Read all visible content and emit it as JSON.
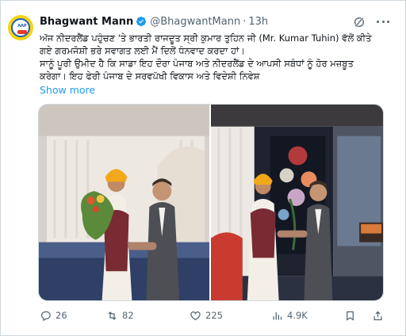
{
  "tweet": {
    "author_name": "Bhagwant Mann",
    "handle": "@BhagwantMann",
    "separator": "·",
    "time": "13h",
    "text_lines": [
      "ਅੱਜ ਨੀਦਰਲੈਂਡ ਪਹੁੰਚਣ 'ਤੇ ਭਾਰਤੀ ਰਾਜਦੂਤ ਸ੍ਰੀ ਕੁਮਾਰ ਤੁਹਿਨ ਜੀ (Mr. Kumar Tuhin) ਵੱਲੋਂ ਕੀਤੇ",
      "ਗਏ ਗਰਮਜੋਸ਼ੀ ਭਰੇ ਸਵਾਗਤ ਲਈ ਮੈਂ ਦਿਲੋਂ ਧੰਨਵਾਦ ਕਰਦਾ ਹਾਂ।",
      "ਸਾਨੂੰ ਪੂਰੀ ਉਮੀਦ ਹੈ ਕਿ ਸਾਡਾ ਇਹ ਦੌਰਾ ਪੰਜਾਬ ਅਤੇ ਨੀਦਰਲੈਂਡ ਦੇ ਆਪਸੀ ਸਬੰਧਾਂ ਨੂੰ ਹੋਰ ਮਜ਼ਬੂਤ",
      "ਕਰੇਗਾ। ਇਹ ਫੇਰੀ ਪੰਜਾਬ ਦੇ ਸਰਵਪੱਖੀ ਵਿਕਾਸ ਅਤੇ ਵਿਦੇਸ਼ੀ ਨਿਵੇਸ਼"
    ],
    "show_more": "Show more"
  },
  "actions": {
    "replies": "26",
    "reposts": "82",
    "likes": "225",
    "views": "4.9K"
  },
  "icons": {
    "verified": "verified-badge-icon",
    "grok": "grok-icon",
    "more": "more-options-icon",
    "reply": "reply-icon",
    "repost": "repost-icon",
    "like": "heart-icon",
    "views": "views-chart-icon",
    "bookmark": "bookmark-icon",
    "share": "share-icon"
  },
  "colors": {
    "accent": "#1d9bf0",
    "text": "#0f1419",
    "muted": "#536471",
    "border": "#cfd9de"
  }
}
